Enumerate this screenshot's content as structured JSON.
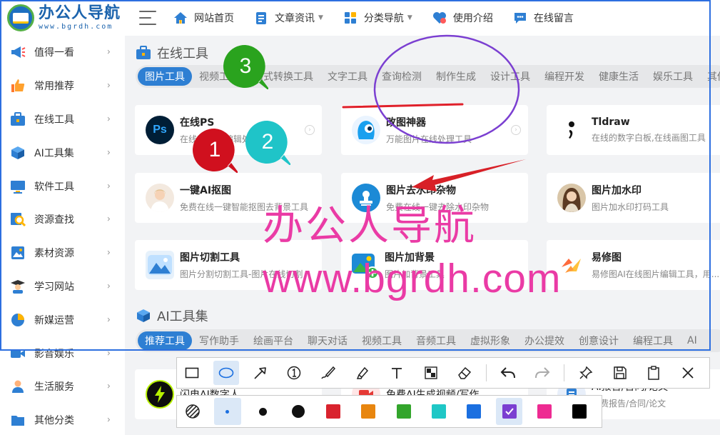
{
  "brand": {
    "title": "办公人导航",
    "url": "www.bgrdh.com"
  },
  "nav": [
    {
      "label": "网站首页",
      "icon": "home-icon",
      "dropdown": false
    },
    {
      "label": "文章资讯",
      "icon": "document-icon",
      "dropdown": true
    },
    {
      "label": "分类导航",
      "icon": "grid-icon",
      "dropdown": true
    },
    {
      "label": "使用介绍",
      "icon": "heart-icon",
      "dropdown": false
    },
    {
      "label": "在线留言",
      "icon": "chat-icon",
      "dropdown": false
    }
  ],
  "sidebar": [
    {
      "label": "值得一看",
      "icon": "megaphone-icon"
    },
    {
      "label": "常用推荐",
      "icon": "thumbs-up-icon"
    },
    {
      "label": "在线工具",
      "icon": "toolbox-icon"
    },
    {
      "label": "AI工具集",
      "icon": "cube-icon"
    },
    {
      "label": "软件工具",
      "icon": "monitor-icon"
    },
    {
      "label": "资源查找",
      "icon": "search-icon"
    },
    {
      "label": "素材资源",
      "icon": "image-icon"
    },
    {
      "label": "学习网站",
      "icon": "student-icon"
    },
    {
      "label": "新媒运营",
      "icon": "pie-chart-icon"
    },
    {
      "label": "影音娱乐",
      "icon": "video-icon"
    },
    {
      "label": "生活服务",
      "icon": "person-icon"
    },
    {
      "label": "其他分类",
      "icon": "folder-icon"
    }
  ],
  "section_online": {
    "title": "在线工具",
    "tabs": [
      "图片工具",
      "视频工具",
      "格式转换工具",
      "文字工具",
      "查询检测",
      "制作生成",
      "设计工具",
      "编程开发",
      "健康生活",
      "娱乐工具",
      "其他"
    ],
    "active_tab": "图片工具",
    "cards": [
      {
        "name": "在线PS",
        "desc": "在线PS图片编辑处理工具",
        "icon": "photoshop-icon"
      },
      {
        "name": "改图神器",
        "desc": "万能图片在线处理工具",
        "icon": "blue-mascot-icon"
      },
      {
        "name": "Tldraw",
        "desc": "在线的数字白板,在线画图工具",
        "icon": "tldraw-icon"
      },
      {
        "name": "一键AI抠图",
        "desc": "免费在线一键智能抠图去背景工具",
        "icon": "portrait-icon"
      },
      {
        "name": "图片去水印杂物",
        "desc": "免费在线一键去除水印杂物",
        "icon": "stamp-icon"
      },
      {
        "name": "图片加水印",
        "desc": "图片加水印打码工具",
        "icon": "portrait-icon"
      },
      {
        "name": "图片切割工具",
        "desc": "图片分割切割工具-图片在线切割",
        "icon": "mountain-icon"
      },
      {
        "name": "图片加背景",
        "desc": "图片加背景工具",
        "icon": "picture-add-icon"
      },
      {
        "name": "易修图",
        "desc": "易修图AI在线图片编辑工具，用...",
        "icon": "yixiutu-icon"
      }
    ]
  },
  "section_ai": {
    "title": "AI工具集",
    "tabs": [
      "推荐工具",
      "写作助手",
      "绘画平台",
      "聊天对话",
      "视频工具",
      "音频工具",
      "虚拟形象",
      "办公提效",
      "创意设计",
      "编程工具",
      "AI"
    ],
    "active_tab": "推荐工具",
    "cards": [
      {
        "name": "闪电AI数字人",
        "desc": "",
        "icon": "lightning-icon"
      },
      {
        "name": "免费AI生成视频/写作",
        "desc": "",
        "icon": "video-icon"
      },
      {
        "name": "AI报告/合同/论文",
        "desc": "免费报告/合同/论文",
        "icon": "document-icon"
      }
    ]
  },
  "annotations": {
    "markers": [
      "1",
      "2",
      "3"
    ],
    "marker_colors": [
      "#d0101e",
      "#1fc4c8",
      "#2aa31e"
    ],
    "watermark_text": "办公人导航",
    "watermark_url": "www.bgrdh.com",
    "watermark_color": "#ea3ba5"
  },
  "toolbar": {
    "tools": [
      "rectangle-icon",
      "ellipse-icon",
      "arrow-icon",
      "numbered-marker-icon",
      "pen-icon",
      "highlighter-icon",
      "text-icon",
      "mosaic-icon",
      "eraser-icon",
      "undo-icon",
      "redo-icon",
      "pin-icon",
      "save-icon",
      "copy-icon",
      "close-icon"
    ],
    "active_tool": "ellipse-icon",
    "sizes": [
      "small",
      "medium",
      "large"
    ],
    "active_size": "small",
    "colors": [
      "#d9232e",
      "#e8860f",
      "#33a52c",
      "#1fc7c6",
      "#1b6fe0",
      "#7b3fd1",
      "#ee2b92",
      "#000000"
    ],
    "active_color": "#7b3fd1"
  }
}
